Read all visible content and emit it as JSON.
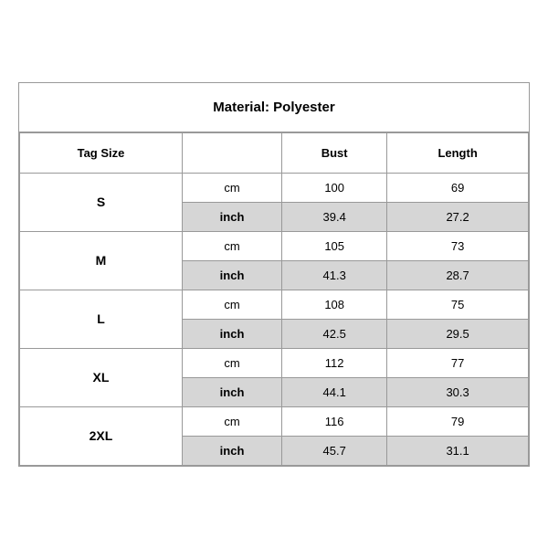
{
  "title": "Material: Polyester",
  "headers": {
    "tag_size": "Tag Size",
    "bust": "Bust",
    "length": "Length"
  },
  "sizes": [
    {
      "tag": "S",
      "cm": {
        "bust": "100",
        "length": "69"
      },
      "inch": {
        "bust": "39.4",
        "length": "27.2"
      }
    },
    {
      "tag": "M",
      "cm": {
        "bust": "105",
        "length": "73"
      },
      "inch": {
        "bust": "41.3",
        "length": "28.7"
      }
    },
    {
      "tag": "L",
      "cm": {
        "bust": "108",
        "length": "75"
      },
      "inch": {
        "bust": "42.5",
        "length": "29.5"
      }
    },
    {
      "tag": "XL",
      "cm": {
        "bust": "112",
        "length": "77"
      },
      "inch": {
        "bust": "44.1",
        "length": "30.3"
      }
    },
    {
      "tag": "2XL",
      "cm": {
        "bust": "116",
        "length": "79"
      },
      "inch": {
        "bust": "45.7",
        "length": "31.1"
      }
    }
  ],
  "units": {
    "cm": "cm",
    "inch": "inch"
  }
}
